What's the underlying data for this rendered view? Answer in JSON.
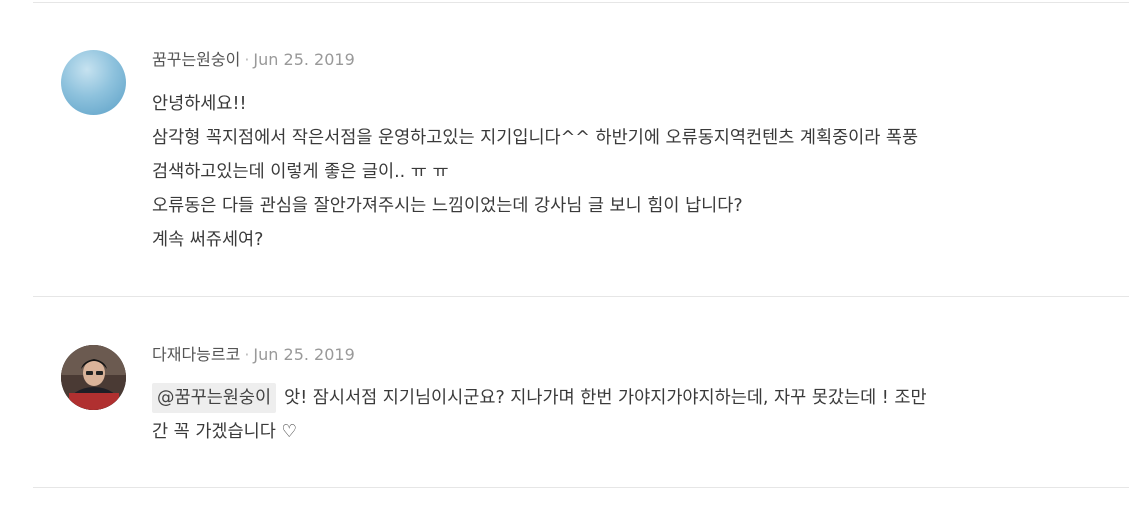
{
  "comments": [
    {
      "author": "꿈꾸는원숭이",
      "separator": "·",
      "date": "Jun 25. 2019",
      "lines": [
        "안녕하세요!!",
        "삼각형 꼭지점에서 작은서점을 운영하고있는 지기입니다^^ 하반기에 오류동지역컨텐츠 계획중이라 폭풍",
        "검색하고있는데 이렇게 좋은 글이.. ㅠ ㅠ",
        "오류동은 다들 관심을 잘안가져주시는 느낌이었는데 강사님 글 보니 힘이 납니다?",
        "계속 써쥬세여?"
      ]
    },
    {
      "author": "다재다능르코",
      "separator": "·",
      "date": "Jun 25. 2019",
      "mention": "@꿈꾸는원숭이",
      "lines": [
        "앗! 잠시서점 지기님이시군요? 지나가며 한번 가야지가야지하는데, 자꾸 못갔는데 ! 조만",
        "간 꼭 가겠습니다 ♡"
      ]
    }
  ]
}
